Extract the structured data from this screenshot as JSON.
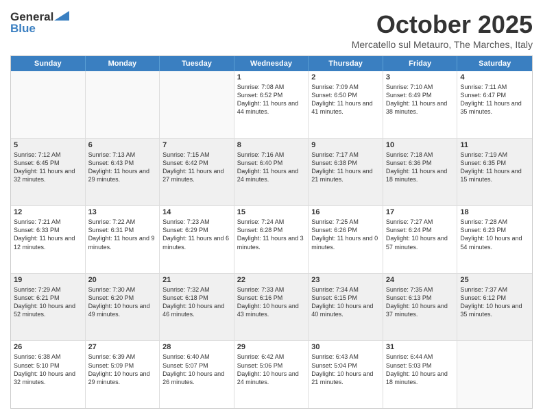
{
  "header": {
    "logo_general": "General",
    "logo_blue": "Blue",
    "month_title": "October 2025",
    "location": "Mercatello sul Metauro, The Marches, Italy"
  },
  "days_of_week": [
    "Sunday",
    "Monday",
    "Tuesday",
    "Wednesday",
    "Thursday",
    "Friday",
    "Saturday"
  ],
  "weeks": [
    [
      {
        "day": "",
        "empty": true
      },
      {
        "day": "",
        "empty": true
      },
      {
        "day": "",
        "empty": true
      },
      {
        "day": "1",
        "sunrise": "Sunrise: 7:08 AM",
        "sunset": "Sunset: 6:52 PM",
        "daylight": "Daylight: 11 hours and 44 minutes."
      },
      {
        "day": "2",
        "sunrise": "Sunrise: 7:09 AM",
        "sunset": "Sunset: 6:50 PM",
        "daylight": "Daylight: 11 hours and 41 minutes."
      },
      {
        "day": "3",
        "sunrise": "Sunrise: 7:10 AM",
        "sunset": "Sunset: 6:49 PM",
        "daylight": "Daylight: 11 hours and 38 minutes."
      },
      {
        "day": "4",
        "sunrise": "Sunrise: 7:11 AM",
        "sunset": "Sunset: 6:47 PM",
        "daylight": "Daylight: 11 hours and 35 minutes."
      }
    ],
    [
      {
        "day": "5",
        "sunrise": "Sunrise: 7:12 AM",
        "sunset": "Sunset: 6:45 PM",
        "daylight": "Daylight: 11 hours and 32 minutes."
      },
      {
        "day": "6",
        "sunrise": "Sunrise: 7:13 AM",
        "sunset": "Sunset: 6:43 PM",
        "daylight": "Daylight: 11 hours and 29 minutes."
      },
      {
        "day": "7",
        "sunrise": "Sunrise: 7:15 AM",
        "sunset": "Sunset: 6:42 PM",
        "daylight": "Daylight: 11 hours and 27 minutes."
      },
      {
        "day": "8",
        "sunrise": "Sunrise: 7:16 AM",
        "sunset": "Sunset: 6:40 PM",
        "daylight": "Daylight: 11 hours and 24 minutes."
      },
      {
        "day": "9",
        "sunrise": "Sunrise: 7:17 AM",
        "sunset": "Sunset: 6:38 PM",
        "daylight": "Daylight: 11 hours and 21 minutes."
      },
      {
        "day": "10",
        "sunrise": "Sunrise: 7:18 AM",
        "sunset": "Sunset: 6:36 PM",
        "daylight": "Daylight: 11 hours and 18 minutes."
      },
      {
        "day": "11",
        "sunrise": "Sunrise: 7:19 AM",
        "sunset": "Sunset: 6:35 PM",
        "daylight": "Daylight: 11 hours and 15 minutes."
      }
    ],
    [
      {
        "day": "12",
        "sunrise": "Sunrise: 7:21 AM",
        "sunset": "Sunset: 6:33 PM",
        "daylight": "Daylight: 11 hours and 12 minutes."
      },
      {
        "day": "13",
        "sunrise": "Sunrise: 7:22 AM",
        "sunset": "Sunset: 6:31 PM",
        "daylight": "Daylight: 11 hours and 9 minutes."
      },
      {
        "day": "14",
        "sunrise": "Sunrise: 7:23 AM",
        "sunset": "Sunset: 6:29 PM",
        "daylight": "Daylight: 11 hours and 6 minutes."
      },
      {
        "day": "15",
        "sunrise": "Sunrise: 7:24 AM",
        "sunset": "Sunset: 6:28 PM",
        "daylight": "Daylight: 11 hours and 3 minutes."
      },
      {
        "day": "16",
        "sunrise": "Sunrise: 7:25 AM",
        "sunset": "Sunset: 6:26 PM",
        "daylight": "Daylight: 11 hours and 0 minutes."
      },
      {
        "day": "17",
        "sunrise": "Sunrise: 7:27 AM",
        "sunset": "Sunset: 6:24 PM",
        "daylight": "Daylight: 10 hours and 57 minutes."
      },
      {
        "day": "18",
        "sunrise": "Sunrise: 7:28 AM",
        "sunset": "Sunset: 6:23 PM",
        "daylight": "Daylight: 10 hours and 54 minutes."
      }
    ],
    [
      {
        "day": "19",
        "sunrise": "Sunrise: 7:29 AM",
        "sunset": "Sunset: 6:21 PM",
        "daylight": "Daylight: 10 hours and 52 minutes."
      },
      {
        "day": "20",
        "sunrise": "Sunrise: 7:30 AM",
        "sunset": "Sunset: 6:20 PM",
        "daylight": "Daylight: 10 hours and 49 minutes."
      },
      {
        "day": "21",
        "sunrise": "Sunrise: 7:32 AM",
        "sunset": "Sunset: 6:18 PM",
        "daylight": "Daylight: 10 hours and 46 minutes."
      },
      {
        "day": "22",
        "sunrise": "Sunrise: 7:33 AM",
        "sunset": "Sunset: 6:16 PM",
        "daylight": "Daylight: 10 hours and 43 minutes."
      },
      {
        "day": "23",
        "sunrise": "Sunrise: 7:34 AM",
        "sunset": "Sunset: 6:15 PM",
        "daylight": "Daylight: 10 hours and 40 minutes."
      },
      {
        "day": "24",
        "sunrise": "Sunrise: 7:35 AM",
        "sunset": "Sunset: 6:13 PM",
        "daylight": "Daylight: 10 hours and 37 minutes."
      },
      {
        "day": "25",
        "sunrise": "Sunrise: 7:37 AM",
        "sunset": "Sunset: 6:12 PM",
        "daylight": "Daylight: 10 hours and 35 minutes."
      }
    ],
    [
      {
        "day": "26",
        "sunrise": "Sunrise: 6:38 AM",
        "sunset": "Sunset: 5:10 PM",
        "daylight": "Daylight: 10 hours and 32 minutes."
      },
      {
        "day": "27",
        "sunrise": "Sunrise: 6:39 AM",
        "sunset": "Sunset: 5:09 PM",
        "daylight": "Daylight: 10 hours and 29 minutes."
      },
      {
        "day": "28",
        "sunrise": "Sunrise: 6:40 AM",
        "sunset": "Sunset: 5:07 PM",
        "daylight": "Daylight: 10 hours and 26 minutes."
      },
      {
        "day": "29",
        "sunrise": "Sunrise: 6:42 AM",
        "sunset": "Sunset: 5:06 PM",
        "daylight": "Daylight: 10 hours and 24 minutes."
      },
      {
        "day": "30",
        "sunrise": "Sunrise: 6:43 AM",
        "sunset": "Sunset: 5:04 PM",
        "daylight": "Daylight: 10 hours and 21 minutes."
      },
      {
        "day": "31",
        "sunrise": "Sunrise: 6:44 AM",
        "sunset": "Sunset: 5:03 PM",
        "daylight": "Daylight: 10 hours and 18 minutes."
      },
      {
        "day": "",
        "empty": true
      }
    ]
  ]
}
